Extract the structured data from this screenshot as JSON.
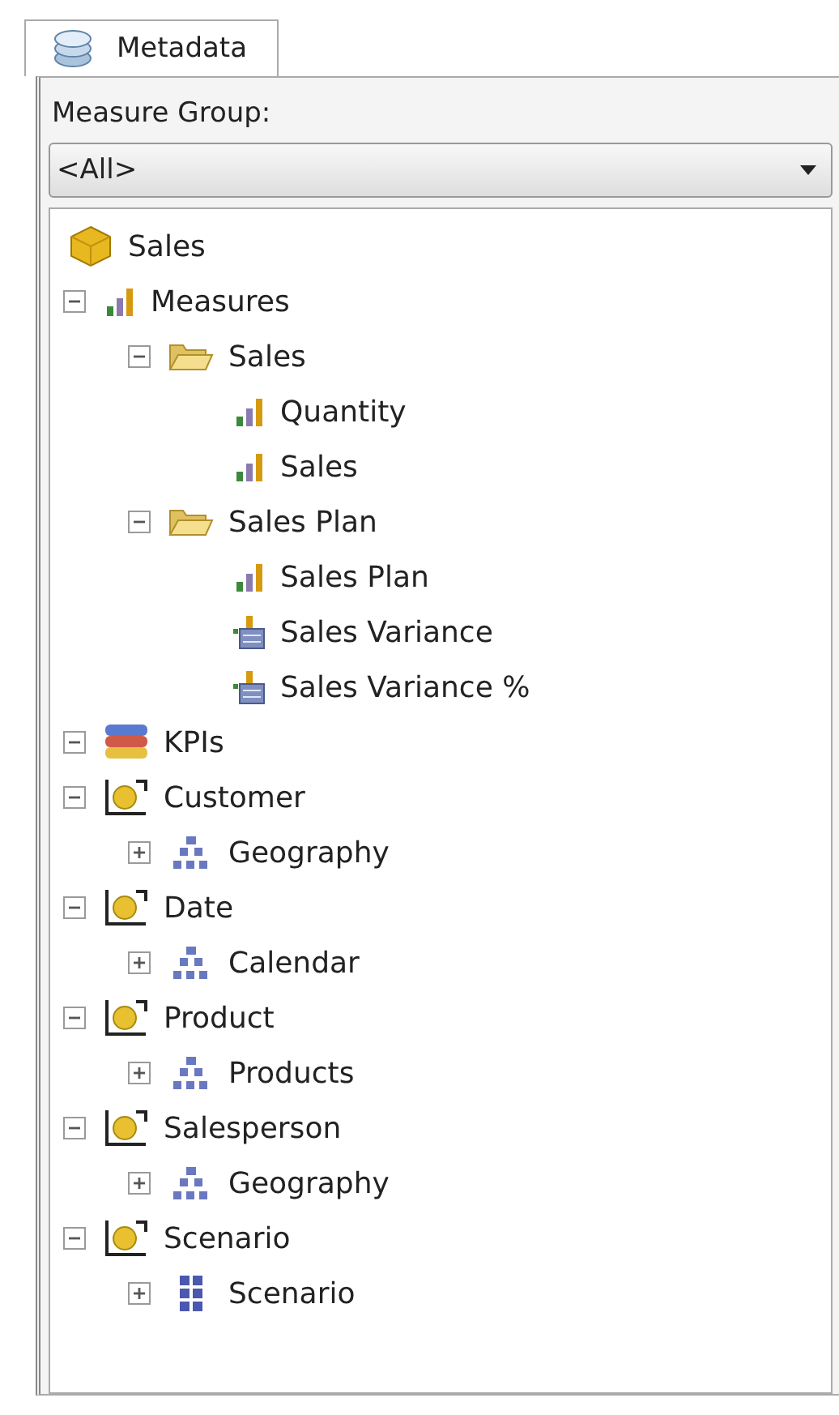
{
  "tabs": [
    {
      "label": "Metadata",
      "selected": true
    }
  ],
  "measure_group": {
    "label": "Measure Group:",
    "value": "<All>"
  },
  "tree": [
    {
      "label": "Sales",
      "kind": "cube",
      "children": [
        {
          "label": "Measures",
          "kind": "measures",
          "expanded": true,
          "children": [
            {
              "label": "Sales",
              "kind": "folder",
              "expanded": true,
              "children": [
                {
                  "label": "Quantity",
                  "kind": "measure"
                },
                {
                  "label": "Sales",
                  "kind": "measure"
                }
              ]
            },
            {
              "label": "Sales Plan",
              "kind": "folder",
              "expanded": true,
              "children": [
                {
                  "label": "Sales Plan",
                  "kind": "measure"
                },
                {
                  "label": "Sales Variance",
                  "kind": "calculated"
                },
                {
                  "label": "Sales Variance %",
                  "kind": "calculated"
                }
              ]
            }
          ]
        },
        {
          "label": "KPIs",
          "kind": "kpis",
          "expanded": true
        },
        {
          "label": "Customer",
          "kind": "dimension",
          "expanded": true,
          "children": [
            {
              "label": "Geography",
              "kind": "hierarchy",
              "expanded": false
            }
          ]
        },
        {
          "label": "Date",
          "kind": "dimension",
          "expanded": true,
          "children": [
            {
              "label": "Calendar",
              "kind": "hierarchy",
              "expanded": false
            }
          ]
        },
        {
          "label": "Product",
          "kind": "dimension",
          "expanded": true,
          "children": [
            {
              "label": "Products",
              "kind": "hierarchy",
              "expanded": false
            }
          ]
        },
        {
          "label": "Salesperson",
          "kind": "dimension",
          "expanded": true,
          "children": [
            {
              "label": "Geography",
              "kind": "hierarchy",
              "expanded": false
            }
          ]
        },
        {
          "label": "Scenario",
          "kind": "dimension",
          "expanded": true,
          "children": [
            {
              "label": "Scenario",
              "kind": "attribute",
              "expanded": false
            }
          ]
        }
      ]
    }
  ]
}
